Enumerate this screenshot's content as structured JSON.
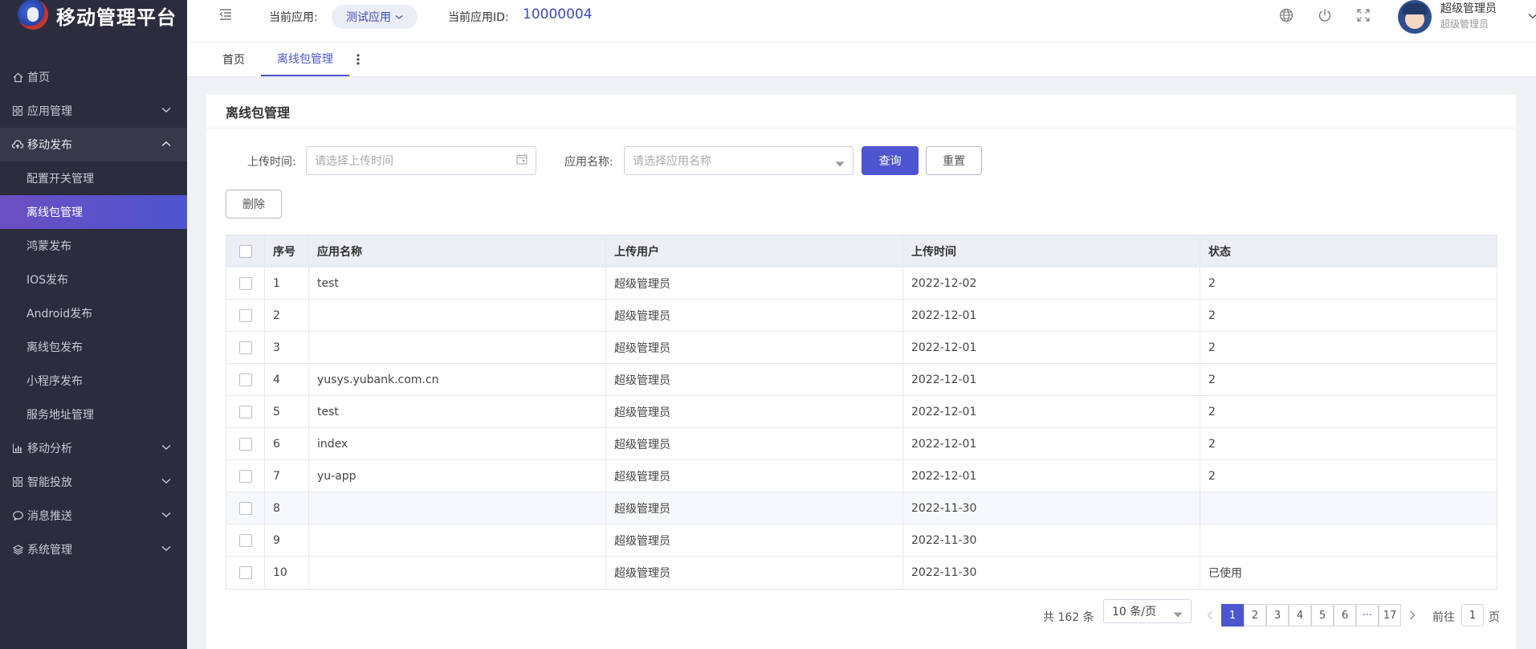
{
  "brand": {
    "title": "移动管理平台"
  },
  "sidebar": {
    "items": [
      {
        "label": "首页",
        "icon": "home-icon"
      },
      {
        "label": "应用管理",
        "icon": "grid-icon"
      },
      {
        "label": "移动发布",
        "icon": "cloud-upload-icon",
        "expanded": true,
        "children": [
          {
            "label": "配置开关管理"
          },
          {
            "label": "离线包管理",
            "active": true
          },
          {
            "label": "鸿蒙发布"
          },
          {
            "label": "IOS发布"
          },
          {
            "label": "Android发布"
          },
          {
            "label": "离线包发布"
          },
          {
            "label": "小程序发布"
          },
          {
            "label": "服务地址管理"
          }
        ]
      },
      {
        "label": "移动分析",
        "icon": "bar-chart-icon"
      },
      {
        "label": "智能投放",
        "icon": "grid-icon"
      },
      {
        "label": "消息推送",
        "icon": "message-icon"
      },
      {
        "label": "系统管理",
        "icon": "layers-icon"
      }
    ]
  },
  "header": {
    "current_app_label": "当前应用:",
    "current_app_value": "测试应用",
    "current_app_id_label": "当前应用ID:",
    "current_app_id_value": "10000004",
    "user_name": "超级管理员",
    "user_role": "超级管理员"
  },
  "tabs": [
    {
      "label": "首页",
      "active": false
    },
    {
      "label": "离线包管理",
      "active": true
    }
  ],
  "page": {
    "title": "离线包管理",
    "filters": {
      "upload_time_label": "上传时间:",
      "upload_time_placeholder": "请选择上传时间",
      "app_name_label": "应用名称:",
      "app_name_placeholder": "请选择应用名称"
    },
    "buttons": {
      "query": "查询",
      "reset": "重置",
      "delete": "删除"
    }
  },
  "table": {
    "columns": [
      "序号",
      "应用名称",
      "上传用户",
      "上传时间",
      "状态"
    ],
    "rows": [
      {
        "no": "1",
        "name": "test",
        "user": "超级管理员",
        "time": "2022-12-02",
        "status": "2"
      },
      {
        "no": "2",
        "name": "",
        "user": "超级管理员",
        "time": "2022-12-01",
        "status": "2"
      },
      {
        "no": "3",
        "name": "",
        "user": "超级管理员",
        "time": "2022-12-01",
        "status": "2"
      },
      {
        "no": "4",
        "name": "yusys.yubank.com.cn",
        "user": "超级管理员",
        "time": "2022-12-01",
        "status": "2"
      },
      {
        "no": "5",
        "name": "test",
        "user": "超级管理员",
        "time": "2022-12-01",
        "status": "2"
      },
      {
        "no": "6",
        "name": "index",
        "user": "超级管理员",
        "time": "2022-12-01",
        "status": "2"
      },
      {
        "no": "7",
        "name": "yu-app",
        "user": "超级管理员",
        "time": "2022-12-01",
        "status": "2"
      },
      {
        "no": "8",
        "name": "",
        "user": "超级管理员",
        "time": "2022-11-30",
        "status": ""
      },
      {
        "no": "9",
        "name": "",
        "user": "超级管理员",
        "time": "2022-11-30",
        "status": ""
      },
      {
        "no": "10",
        "name": "",
        "user": "超级管理员",
        "time": "2022-11-30",
        "status": "已使用"
      }
    ]
  },
  "pagination": {
    "total": "共 162 条",
    "page_size": "10 条/页",
    "pages": [
      "1",
      "2",
      "3",
      "4",
      "5",
      "6",
      "···",
      "17"
    ],
    "current": "1",
    "goto_label": "前往",
    "goto_value": "1",
    "goto_suffix": "页"
  },
  "colors": {
    "accent": "#4d55cf",
    "sidebar_bg": "#2b2c3d",
    "sidebar_active": "#5a52cc"
  }
}
